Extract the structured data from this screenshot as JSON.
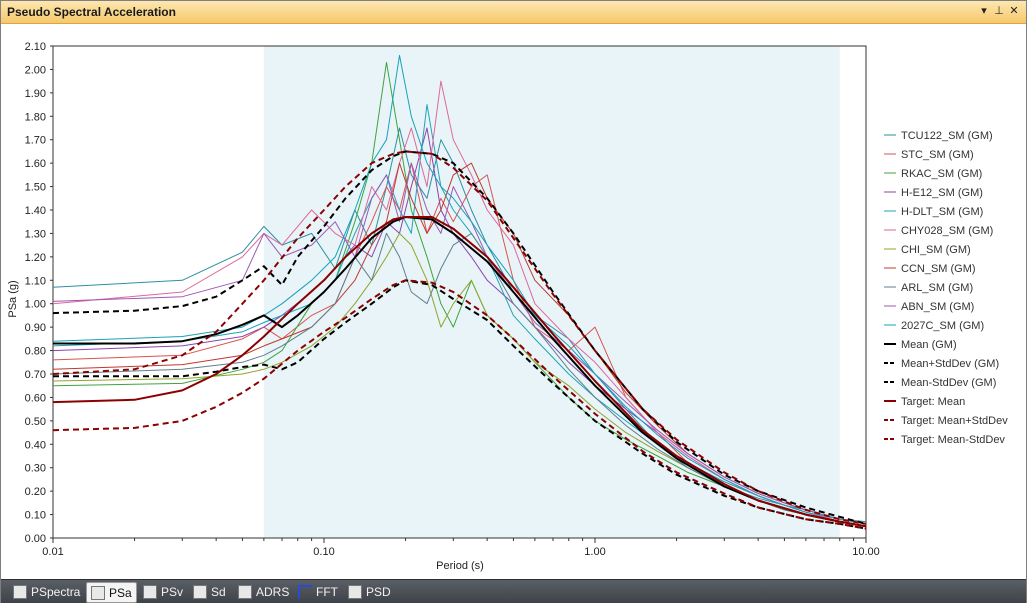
{
  "window": {
    "title": "Pseudo Spectral Acceleration"
  },
  "titlebar_buttons": [
    {
      "name": "dropdown-icon",
      "glyph": "▾"
    },
    {
      "name": "pin-icon",
      "glyph": "⊥"
    },
    {
      "name": "close-icon",
      "glyph": "✕"
    }
  ],
  "tabs": [
    {
      "label": "PSpectra",
      "icon": "pspectra-icon",
      "active": false
    },
    {
      "label": "PSa",
      "icon": "psa-icon",
      "active": true
    },
    {
      "label": "PSv",
      "icon": "psv-icon",
      "active": false
    },
    {
      "label": "Sd",
      "icon": "sd-icon",
      "active": false
    },
    {
      "label": "ADRS",
      "icon": "adrs-icon",
      "active": false
    },
    {
      "label": "FFT",
      "icon": "fft-icon",
      "active": false
    },
    {
      "label": "PSD",
      "icon": "psd-icon",
      "active": false
    }
  ],
  "chart_data": {
    "type": "line",
    "xlabel": "Period (s)",
    "ylabel": "PSa (g)",
    "xscale": "log",
    "xlim": [
      0.01,
      10
    ],
    "ylim": [
      0,
      2.1
    ],
    "xticks": [
      0.01,
      0.1,
      1,
      10
    ],
    "xtick_labels": [
      "0.01",
      "0.10",
      "1.00",
      "10.00"
    ],
    "yticks": [
      0,
      0.1,
      0.2,
      0.3,
      0.4,
      0.5,
      0.6,
      0.7,
      0.8,
      0.9,
      1.0,
      1.1,
      1.2,
      1.3,
      1.4,
      1.5,
      1.6,
      1.7,
      1.8,
      1.9,
      2.0,
      2.1
    ],
    "ytick_labels": [
      "0.00",
      "0.10",
      "0.20",
      "0.30",
      "0.40",
      "0.50",
      "0.60",
      "0.70",
      "0.80",
      "0.90",
      "1.00",
      "1.10",
      "1.20",
      "1.30",
      "1.40",
      "1.50",
      "1.60",
      "1.70",
      "1.80",
      "1.90",
      "2.00",
      "2.10"
    ],
    "shaded_period_range": [
      0.06,
      8.0
    ],
    "shade_color": "#e8f4f7",
    "legend_position": "right",
    "series": [
      {
        "name": "TCU122_SM (GM)",
        "color": "#2e8fa3",
        "dash": "none",
        "width": 1,
        "x": [
          0.01,
          0.03,
          0.05,
          0.06,
          0.07,
          0.09,
          0.11,
          0.13,
          0.15,
          0.17,
          0.19,
          0.21,
          0.24,
          0.27,
          0.3,
          0.35,
          0.4,
          0.5,
          0.6,
          0.8,
          1.0,
          1.3,
          1.7,
          2.2,
          3,
          4,
          5,
          6,
          8,
          10
        ],
        "y": [
          1.07,
          1.1,
          1.22,
          1.33,
          1.25,
          1.3,
          1.15,
          1.4,
          1.25,
          1.5,
          1.75,
          1.55,
          1.45,
          1.7,
          1.6,
          1.4,
          1.25,
          1.05,
          0.95,
          0.85,
          0.7,
          0.55,
          0.4,
          0.3,
          0.22,
          0.17,
          0.14,
          0.12,
          0.08,
          0.07
        ]
      },
      {
        "name": "STC_SM (GM)",
        "color": "#d9534f",
        "dash": "none",
        "width": 1,
        "x": [
          0.01,
          0.03,
          0.05,
          0.06,
          0.07,
          0.09,
          0.11,
          0.13,
          0.15,
          0.17,
          0.19,
          0.21,
          0.24,
          0.27,
          0.3,
          0.35,
          0.4,
          0.5,
          0.6,
          0.8,
          1.0,
          1.3,
          1.7,
          2.2,
          3,
          4,
          5,
          6,
          8,
          10
        ],
        "y": [
          0.76,
          0.78,
          0.85,
          0.9,
          0.85,
          0.95,
          1.0,
          1.2,
          1.35,
          1.5,
          1.4,
          1.6,
          1.3,
          1.45,
          1.35,
          1.5,
          1.55,
          1.1,
          0.9,
          0.8,
          0.9,
          0.6,
          0.45,
          0.32,
          0.24,
          0.18,
          0.14,
          0.11,
          0.07,
          0.05
        ]
      },
      {
        "name": "RKAC_SM (GM)",
        "color": "#3fa33f",
        "dash": "none",
        "width": 1,
        "x": [
          0.01,
          0.03,
          0.05,
          0.06,
          0.07,
          0.09,
          0.11,
          0.13,
          0.15,
          0.17,
          0.19,
          0.21,
          0.24,
          0.27,
          0.3,
          0.35,
          0.4,
          0.5,
          0.6,
          0.8,
          1.0,
          1.3,
          1.7,
          2.2,
          3,
          4,
          5,
          6,
          8,
          10
        ],
        "y": [
          0.65,
          0.66,
          0.72,
          0.75,
          0.8,
          1.0,
          1.1,
          1.35,
          1.6,
          2.03,
          1.7,
          1.4,
          1.2,
          1.0,
          0.9,
          1.1,
          0.95,
          0.85,
          0.75,
          0.6,
          0.5,
          0.42,
          0.35,
          0.28,
          0.22,
          0.16,
          0.12,
          0.1,
          0.07,
          0.05
        ]
      },
      {
        "name": "H-E12_SM (GM)",
        "color": "#8e44ad",
        "dash": "none",
        "width": 1,
        "x": [
          0.01,
          0.03,
          0.05,
          0.06,
          0.07,
          0.09,
          0.11,
          0.13,
          0.15,
          0.17,
          0.19,
          0.21,
          0.24,
          0.27,
          0.3,
          0.35,
          0.4,
          0.5,
          0.6,
          0.8,
          1.0,
          1.3,
          1.7,
          2.2,
          3,
          4,
          5,
          6,
          8,
          10
        ],
        "y": [
          0.8,
          0.82,
          0.86,
          0.9,
          0.95,
          1.05,
          1.15,
          1.25,
          1.2,
          1.35,
          1.3,
          1.5,
          1.75,
          1.4,
          1.3,
          1.2,
          1.1,
          1.0,
          0.9,
          0.75,
          0.65,
          0.55,
          0.45,
          0.35,
          0.25,
          0.18,
          0.14,
          0.11,
          0.07,
          0.05
        ]
      },
      {
        "name": "H-DLT_SM (GM)",
        "color": "#1fa3b8",
        "dash": "none",
        "width": 1,
        "x": [
          0.01,
          0.03,
          0.05,
          0.06,
          0.07,
          0.09,
          0.11,
          0.13,
          0.15,
          0.17,
          0.19,
          0.21,
          0.24,
          0.27,
          0.3,
          0.35,
          0.4,
          0.5,
          0.6,
          0.8,
          1.0,
          1.3,
          1.7,
          2.2,
          3,
          4,
          5,
          6,
          8,
          10
        ],
        "y": [
          0.82,
          0.84,
          0.88,
          0.92,
          0.95,
          1.0,
          1.1,
          1.3,
          1.45,
          1.55,
          1.4,
          1.3,
          1.85,
          1.5,
          1.4,
          1.3,
          1.2,
          0.95,
          0.85,
          0.7,
          0.6,
          0.5,
          0.4,
          0.32,
          0.24,
          0.18,
          0.14,
          0.11,
          0.07,
          0.05
        ]
      },
      {
        "name": "CHY028_SM (GM)",
        "color": "#e0679b",
        "dash": "none",
        "width": 1,
        "x": [
          0.01,
          0.03,
          0.05,
          0.06,
          0.07,
          0.09,
          0.11,
          0.13,
          0.15,
          0.17,
          0.19,
          0.21,
          0.24,
          0.27,
          0.3,
          0.35,
          0.4,
          0.5,
          0.6,
          0.8,
          1.0,
          1.3,
          1.7,
          2.2,
          3,
          4,
          5,
          6,
          8,
          10
        ],
        "y": [
          1.0,
          1.05,
          1.2,
          1.3,
          1.25,
          1.4,
          1.3,
          1.25,
          1.5,
          1.4,
          1.6,
          1.75,
          1.5,
          1.95,
          1.7,
          1.55,
          1.4,
          1.25,
          1.0,
          0.85,
          0.75,
          0.6,
          0.45,
          0.35,
          0.25,
          0.18,
          0.14,
          0.11,
          0.07,
          0.05
        ]
      },
      {
        "name": "CHI_SM (GM)",
        "color": "#8fa52b",
        "dash": "none",
        "width": 1,
        "x": [
          0.01,
          0.03,
          0.05,
          0.06,
          0.07,
          0.09,
          0.11,
          0.13,
          0.15,
          0.17,
          0.19,
          0.21,
          0.24,
          0.27,
          0.3,
          0.35,
          0.4,
          0.5,
          0.6,
          0.8,
          1.0,
          1.3,
          1.7,
          2.2,
          3,
          4,
          5,
          6,
          8,
          10
        ],
        "y": [
          0.67,
          0.68,
          0.7,
          0.72,
          0.75,
          0.82,
          0.9,
          1.0,
          1.1,
          1.2,
          1.3,
          1.25,
          1.1,
          0.9,
          1.0,
          1.1,
          0.95,
          0.85,
          0.75,
          0.65,
          0.55,
          0.45,
          0.37,
          0.3,
          0.22,
          0.16,
          0.12,
          0.1,
          0.07,
          0.05
        ]
      },
      {
        "name": "CCN_SM (GM)",
        "color": "#c0392b",
        "dash": "none",
        "width": 1,
        "x": [
          0.01,
          0.03,
          0.05,
          0.06,
          0.07,
          0.09,
          0.11,
          0.13,
          0.15,
          0.17,
          0.19,
          0.21,
          0.24,
          0.27,
          0.3,
          0.35,
          0.4,
          0.5,
          0.6,
          0.8,
          1.0,
          1.3,
          1.7,
          2.2,
          3,
          4,
          5,
          6,
          8,
          10
        ],
        "y": [
          0.72,
          0.74,
          0.78,
          0.82,
          0.85,
          0.9,
          1.0,
          1.1,
          1.25,
          1.35,
          1.6,
          1.45,
          1.3,
          1.4,
          1.55,
          1.6,
          1.45,
          1.3,
          1.1,
          0.95,
          0.8,
          0.62,
          0.48,
          0.36,
          0.26,
          0.19,
          0.15,
          0.12,
          0.08,
          0.06
        ]
      },
      {
        "name": "ARL_SM (GM)",
        "color": "#5f7f8f",
        "dash": "none",
        "width": 1,
        "x": [
          0.01,
          0.03,
          0.05,
          0.06,
          0.07,
          0.09,
          0.11,
          0.13,
          0.15,
          0.17,
          0.19,
          0.21,
          0.24,
          0.27,
          0.3,
          0.35,
          0.4,
          0.5,
          0.6,
          0.8,
          1.0,
          1.3,
          1.7,
          2.2,
          3,
          4,
          5,
          6,
          8,
          10
        ],
        "y": [
          0.7,
          0.72,
          0.75,
          0.78,
          0.82,
          0.9,
          1.0,
          1.2,
          1.1,
          1.3,
          1.2,
          1.05,
          1.0,
          1.15,
          1.25,
          1.3,
          1.2,
          1.0,
          0.9,
          0.72,
          0.6,
          0.48,
          0.38,
          0.3,
          0.22,
          0.16,
          0.12,
          0.1,
          0.07,
          0.05
        ]
      },
      {
        "name": "ABN_SM (GM)",
        "color": "#9b59b6",
        "dash": "none",
        "width": 1,
        "x": [
          0.01,
          0.03,
          0.05,
          0.06,
          0.07,
          0.09,
          0.11,
          0.13,
          0.15,
          0.17,
          0.19,
          0.21,
          0.24,
          0.27,
          0.3,
          0.35,
          0.4,
          0.5,
          0.6,
          0.8,
          1.0,
          1.3,
          1.7,
          2.2,
          3,
          4,
          5,
          6,
          8,
          10
        ],
        "y": [
          1.01,
          1.03,
          1.1,
          1.3,
          1.2,
          1.25,
          1.35,
          1.2,
          1.45,
          1.55,
          1.35,
          1.6,
          1.4,
          1.3,
          1.5,
          1.35,
          1.2,
          1.05,
          0.92,
          0.8,
          0.7,
          0.58,
          0.46,
          0.36,
          0.26,
          0.19,
          0.15,
          0.12,
          0.08,
          0.06
        ]
      },
      {
        "name": "2027C_SM (GM)",
        "color": "#17a2b8",
        "dash": "none",
        "width": 1,
        "x": [
          0.01,
          0.03,
          0.05,
          0.06,
          0.07,
          0.09,
          0.11,
          0.13,
          0.15,
          0.17,
          0.19,
          0.21,
          0.24,
          0.27,
          0.3,
          0.35,
          0.4,
          0.5,
          0.6,
          0.8,
          1.0,
          1.3,
          1.7,
          2.2,
          3,
          4,
          5,
          6,
          8,
          10
        ],
        "y": [
          0.84,
          0.86,
          0.9,
          0.95,
          1.0,
          1.1,
          1.2,
          1.4,
          1.6,
          1.7,
          2.06,
          1.8,
          1.6,
          1.5,
          1.45,
          1.35,
          1.25,
          1.1,
          0.95,
          0.82,
          0.7,
          0.56,
          0.44,
          0.34,
          0.25,
          0.18,
          0.14,
          0.11,
          0.08,
          0.06
        ]
      },
      {
        "name": "Mean (GM)",
        "color": "#000000",
        "dash": "none",
        "width": 2,
        "x": [
          0.01,
          0.02,
          0.03,
          0.04,
          0.05,
          0.06,
          0.07,
          0.08,
          0.1,
          0.12,
          0.15,
          0.18,
          0.2,
          0.25,
          0.3,
          0.4,
          0.5,
          0.7,
          1.0,
          1.5,
          2,
          3,
          4,
          6,
          8,
          10
        ],
        "y": [
          0.83,
          0.83,
          0.84,
          0.87,
          0.91,
          0.95,
          0.9,
          0.95,
          1.05,
          1.15,
          1.28,
          1.35,
          1.37,
          1.36,
          1.3,
          1.18,
          1.05,
          0.85,
          0.65,
          0.45,
          0.34,
          0.22,
          0.16,
          0.1,
          0.07,
          0.05
        ]
      },
      {
        "name": "Mean+StdDev (GM)",
        "color": "#000000",
        "dash": "6,4",
        "width": 2,
        "x": [
          0.01,
          0.02,
          0.03,
          0.04,
          0.05,
          0.06,
          0.07,
          0.08,
          0.1,
          0.12,
          0.15,
          0.18,
          0.2,
          0.25,
          0.3,
          0.4,
          0.5,
          0.7,
          1.0,
          1.5,
          2,
          3,
          4,
          6,
          8,
          10
        ],
        "y": [
          0.96,
          0.97,
          0.99,
          1.03,
          1.1,
          1.16,
          1.08,
          1.2,
          1.33,
          1.45,
          1.57,
          1.63,
          1.65,
          1.64,
          1.6,
          1.45,
          1.3,
          1.05,
          0.8,
          0.55,
          0.41,
          0.27,
          0.2,
          0.13,
          0.09,
          0.06
        ]
      },
      {
        "name": "Mean-StdDev (GM)",
        "color": "#000000",
        "dash": "6,4",
        "width": 2,
        "x": [
          0.01,
          0.02,
          0.03,
          0.04,
          0.05,
          0.06,
          0.07,
          0.08,
          0.1,
          0.12,
          0.15,
          0.18,
          0.2,
          0.25,
          0.3,
          0.4,
          0.5,
          0.7,
          1.0,
          1.5,
          2,
          3,
          4,
          6,
          8,
          10
        ],
        "y": [
          0.69,
          0.69,
          0.69,
          0.71,
          0.73,
          0.74,
          0.72,
          0.75,
          0.85,
          0.92,
          1.0,
          1.07,
          1.1,
          1.08,
          1.02,
          0.93,
          0.82,
          0.66,
          0.5,
          0.36,
          0.27,
          0.18,
          0.13,
          0.08,
          0.06,
          0.04
        ]
      },
      {
        "name": "Target: Mean",
        "color": "#8b0000",
        "dash": "none",
        "width": 2,
        "x": [
          0.01,
          0.02,
          0.03,
          0.04,
          0.05,
          0.06,
          0.08,
          0.1,
          0.12,
          0.15,
          0.18,
          0.2,
          0.25,
          0.3,
          0.4,
          0.5,
          0.7,
          1.0,
          1.5,
          2,
          3,
          4,
          6,
          8,
          10
        ],
        "y": [
          0.58,
          0.59,
          0.63,
          0.7,
          0.78,
          0.86,
          1.0,
          1.1,
          1.2,
          1.3,
          1.36,
          1.37,
          1.37,
          1.32,
          1.2,
          1.07,
          0.87,
          0.67,
          0.46,
          0.35,
          0.23,
          0.16,
          0.1,
          0.07,
          0.05
        ]
      },
      {
        "name": "Target: Mean+StdDev",
        "color": "#8b0000",
        "dash": "6,4",
        "width": 2,
        "x": [
          0.01,
          0.02,
          0.03,
          0.04,
          0.05,
          0.06,
          0.08,
          0.1,
          0.12,
          0.15,
          0.18,
          0.2,
          0.25,
          0.3,
          0.4,
          0.5,
          0.7,
          1.0,
          1.5,
          2,
          3,
          4,
          6,
          8,
          10
        ],
        "y": [
          0.7,
          0.72,
          0.78,
          0.88,
          1.0,
          1.1,
          1.28,
          1.4,
          1.5,
          1.6,
          1.64,
          1.65,
          1.64,
          1.58,
          1.44,
          1.28,
          1.04,
          0.8,
          0.55,
          0.42,
          0.28,
          0.2,
          0.12,
          0.08,
          0.06
        ]
      },
      {
        "name": "Target: Mean-StdDev",
        "color": "#8b0000",
        "dash": "6,4",
        "width": 2,
        "x": [
          0.01,
          0.02,
          0.03,
          0.04,
          0.05,
          0.06,
          0.08,
          0.1,
          0.12,
          0.15,
          0.18,
          0.2,
          0.25,
          0.3,
          0.4,
          0.5,
          0.7,
          1.0,
          1.5,
          2,
          3,
          4,
          6,
          8,
          10
        ],
        "y": [
          0.46,
          0.47,
          0.5,
          0.56,
          0.62,
          0.68,
          0.8,
          0.88,
          0.94,
          1.02,
          1.08,
          1.1,
          1.09,
          1.05,
          0.95,
          0.85,
          0.69,
          0.53,
          0.37,
          0.28,
          0.19,
          0.13,
          0.08,
          0.06,
          0.04
        ]
      }
    ]
  }
}
